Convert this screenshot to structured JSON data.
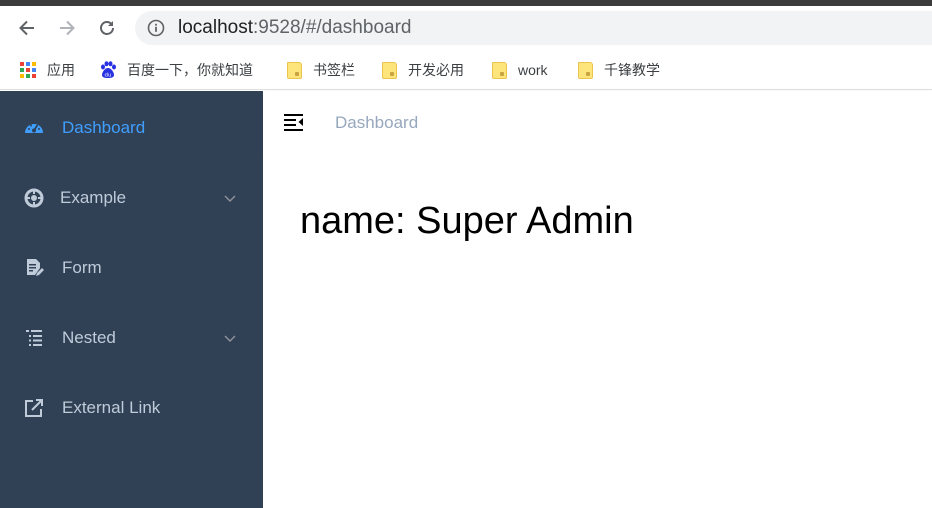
{
  "browser": {
    "url_host": "localhost",
    "url_rest": ":9528/#/dashboard",
    "icons": {
      "back": "arrow-left-icon",
      "forward": "arrow-right-icon",
      "reload": "reload-icon",
      "info": "info-circle-icon"
    }
  },
  "bookmarks": {
    "items": [
      {
        "label": "应用",
        "icon": "apps-grid-icon"
      },
      {
        "label": "百度一下，你就知道",
        "icon": "baidu-paw-icon"
      },
      {
        "label": "书签栏",
        "icon": "folder-icon"
      },
      {
        "label": "开发必用",
        "icon": "folder-icon"
      },
      {
        "label": "work",
        "icon": "folder-icon"
      },
      {
        "label": "千锋教学",
        "icon": "folder-icon"
      }
    ]
  },
  "sidebar": {
    "background": "#304156",
    "text_color": "#bfcbd9",
    "active_color": "#409eff",
    "items": [
      {
        "label": "Dashboard",
        "icon": "dashboard-icon",
        "active": true
      },
      {
        "label": "Example",
        "icon": "example-icon",
        "has_children": true
      },
      {
        "label": "Form",
        "icon": "form-icon"
      },
      {
        "label": "Nested",
        "icon": "nested-icon",
        "has_children": true
      },
      {
        "label": "External Link",
        "icon": "external-link-icon"
      }
    ]
  },
  "header": {
    "breadcrumb": "Dashboard",
    "hamburger_icon": "hamburger-icon"
  },
  "dashboard": {
    "text": "name: Super Admin"
  }
}
